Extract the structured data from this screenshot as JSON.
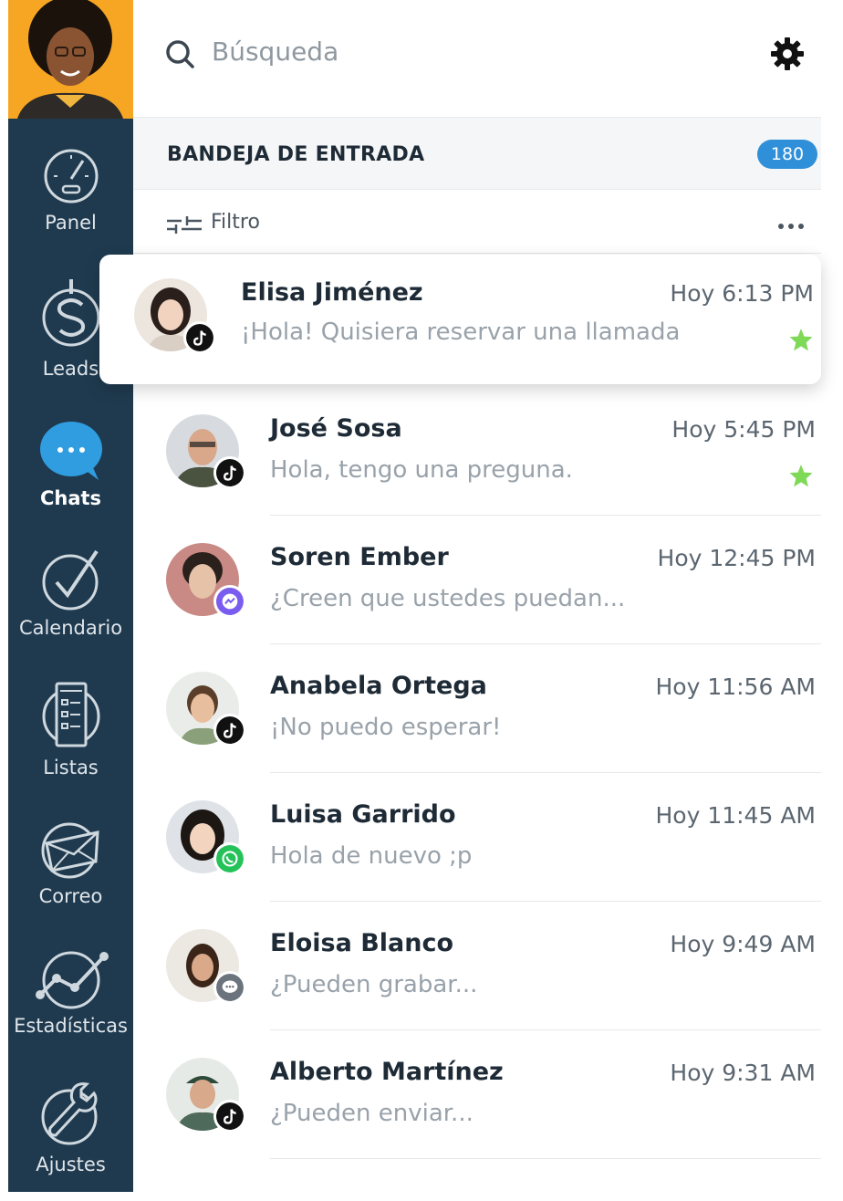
{
  "search": {
    "placeholder": "Búsqueda"
  },
  "inbox": {
    "title": "BANDEJA DE ENTRADA",
    "count": "180"
  },
  "filter": {
    "label": "Filtro"
  },
  "sidebar": {
    "items": [
      {
        "label": "Panel",
        "icon": "speedometer-icon"
      },
      {
        "label": "Leads",
        "icon": "dollar-icon"
      },
      {
        "label": "Chats",
        "icon": "chat-bubble-icon",
        "active": true
      },
      {
        "label": "Calendario",
        "icon": "check-circle-icon"
      },
      {
        "label": "Listas",
        "icon": "list-icon"
      },
      {
        "label": "Correo",
        "icon": "envelope-icon"
      },
      {
        "label": "Estadísticas",
        "icon": "line-chart-icon"
      },
      {
        "label": "Ajustes",
        "icon": "wrench-icon"
      }
    ]
  },
  "chats": [
    {
      "name": "Elisa Jiménez",
      "time": "Hoy 6:13 PM",
      "message": "¡Hola! Quisiera reservar una llamada",
      "channel": "tiktok",
      "starred": true
    },
    {
      "name": "José Sosa",
      "time": "Hoy 5:45 PM",
      "message": "Hola, tengo una preguna.",
      "channel": "tiktok",
      "starred": true
    },
    {
      "name": "Soren Ember",
      "time": "Hoy 12:45 PM",
      "message": "¿Creen que ustedes puedan...",
      "channel": "messenger",
      "starred": false
    },
    {
      "name": "Anabela Ortega",
      "time": "Hoy 11:56 AM",
      "message": "¡No puedo esperar!",
      "channel": "tiktok",
      "starred": false
    },
    {
      "name": "Luisa Garrido",
      "time": "Hoy 11:45 AM",
      "message": "Hola de nuevo ;p",
      "channel": "whatsapp",
      "starred": false
    },
    {
      "name": "Eloisa Blanco",
      "time": "Hoy 9:49 AM",
      "message": "¿Pueden grabar...",
      "channel": "sms",
      "starred": false
    },
    {
      "name": "Alberto Martínez",
      "time": "Hoy 9:31 AM",
      "message": "¿Pueden enviar...",
      "channel": "tiktok",
      "starred": false
    }
  ],
  "colors": {
    "sidebar": "#1f3a4f",
    "accent": "#2f8fd8",
    "star": "#7ed957",
    "profile_bg": "#f6a623"
  }
}
